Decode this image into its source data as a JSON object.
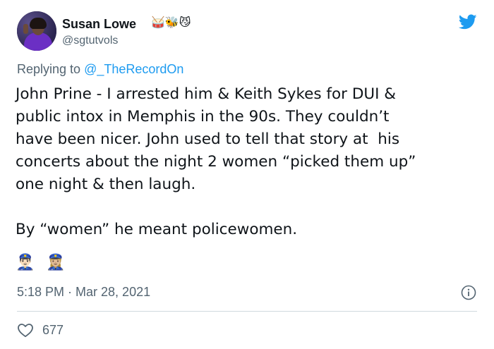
{
  "tweet": {
    "author": {
      "name": "Susan Lowe",
      "name_emojis": "🥁🐝😼",
      "handle": "@sgtutvols"
    },
    "reply": {
      "prefix": "Replying to ",
      "mention": "@_TheRecordOn"
    },
    "text": "John Prine - I arrested him & Keith Sykes for DUI &\npublic intox in Memphis in the 90s. They couldn’t\nhave been nicer. John used to tell that story at  his\nconcerts about the night 2 women “picked them up”\none night & then laugh.\n\nBy “women” he meant policewomen.",
    "emoji_line": "👮🏻‍♂️👮🏼‍♀️",
    "timestamp": "5:18 PM · Mar 28, 2021",
    "likes": "677"
  },
  "colors": {
    "twitter_blue": "#1d9bf0",
    "secondary_text": "#536471",
    "divider": "#cfd9de"
  },
  "icons": {
    "brand": "twitter-bird-icon",
    "info": "info-icon",
    "like": "heart-icon"
  }
}
